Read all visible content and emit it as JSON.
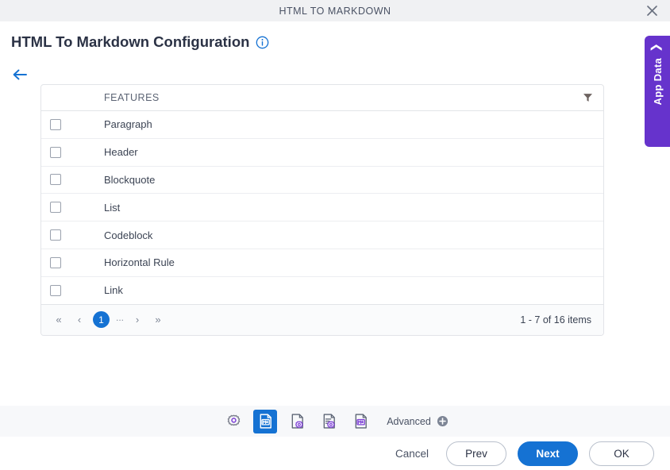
{
  "window": {
    "title": "HTML TO MARKDOWN",
    "close_icon": "close-icon"
  },
  "header": {
    "page_title": "HTML To Markdown Configuration",
    "info_icon": "info-icon",
    "back_icon": "back-arrow-icon"
  },
  "app_data_panel": {
    "label": "App Data",
    "chevron_icon": "chevron-left-icon",
    "color": "#6633cc"
  },
  "grid": {
    "column_header": "FEATURES",
    "filter_icon": "filter-icon",
    "rows": [
      {
        "label": "Paragraph",
        "checked": false
      },
      {
        "label": "Header",
        "checked": false
      },
      {
        "label": "Blockquote",
        "checked": false
      },
      {
        "label": "List",
        "checked": false
      },
      {
        "label": "Codeblock",
        "checked": false
      },
      {
        "label": "Horizontal Rule",
        "checked": false
      },
      {
        "label": "Link",
        "checked": false
      }
    ],
    "pager": {
      "first_icon": "double-chevron-left-icon",
      "prev_icon": "chevron-left-icon",
      "current_page": "1",
      "ellipsis": "...",
      "next_icon": "chevron-right-icon",
      "last_icon": "double-chevron-right-icon",
      "items_info": "1 - 7 of 16 items",
      "accent": "#1572d3"
    }
  },
  "toolbar": {
    "items": [
      {
        "name": "settings-gear-icon",
        "active": false
      },
      {
        "name": "markdown-document-icon",
        "active": true
      },
      {
        "name": "document-settings-icon",
        "active": false
      },
      {
        "name": "document-lines-settings-icon",
        "active": false
      },
      {
        "name": "markdown-file-icon",
        "active": false
      }
    ],
    "advanced_label": "Advanced",
    "advanced_plus_icon": "plus-circle-icon"
  },
  "footer": {
    "cancel_label": "Cancel",
    "prev_label": "Prev",
    "next_label": "Next",
    "ok_label": "OK"
  }
}
